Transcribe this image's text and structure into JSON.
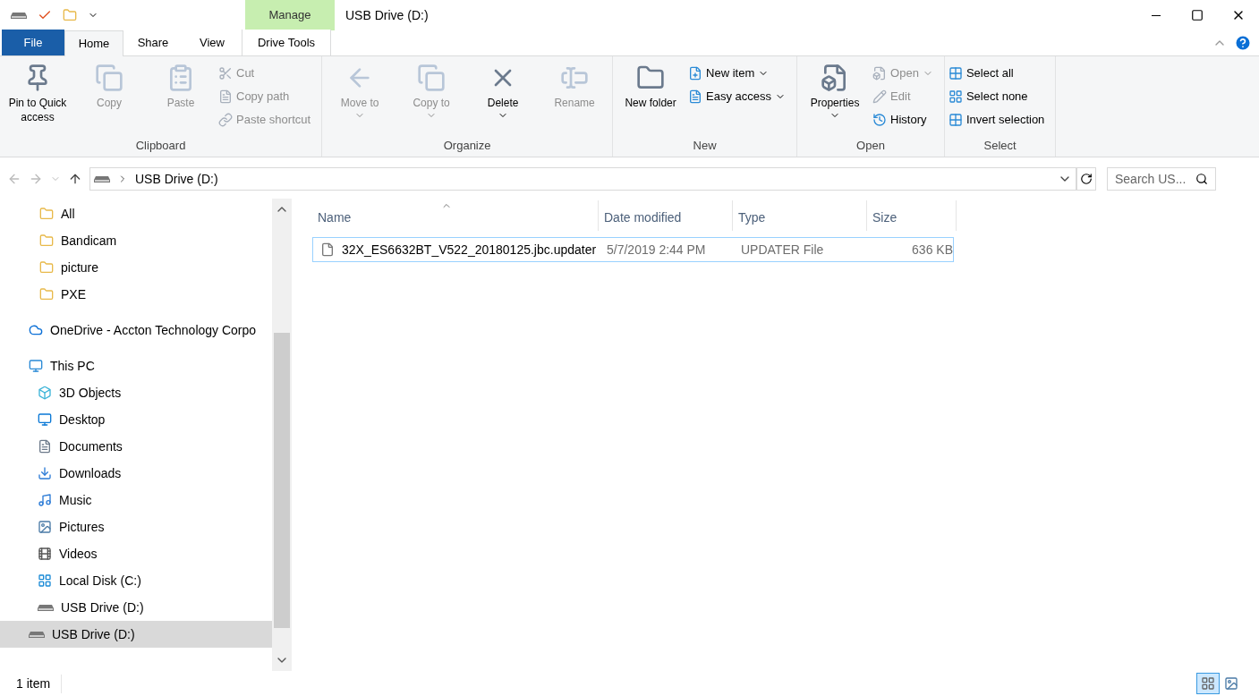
{
  "window": {
    "title": "USB Drive (D:)",
    "context_tab_group": "Manage"
  },
  "tabs": [
    {
      "label": "File",
      "kind": "file",
      "selected": false
    },
    {
      "label": "Home",
      "kind": "tab",
      "selected": true
    },
    {
      "label": "Share",
      "kind": "tab",
      "selected": false
    },
    {
      "label": "View",
      "kind": "tab",
      "selected": false
    },
    {
      "label": "Drive Tools",
      "kind": "context",
      "selected": false
    }
  ],
  "ribbon": [
    {
      "name": "Clipboard",
      "commands": [
        {
          "label": "Pin to Quick access",
          "kind": "large",
          "disabled": false,
          "menu": false
        },
        {
          "label": "Copy",
          "kind": "large",
          "disabled": true,
          "menu": false
        },
        {
          "label": "Paste",
          "kind": "large",
          "disabled": true,
          "menu": false
        },
        {
          "kind": "stack",
          "items": [
            {
              "label": "Cut",
              "disabled": true,
              "menu": false
            },
            {
              "label": "Copy path",
              "disabled": true,
              "menu": false
            },
            {
              "label": "Paste shortcut",
              "disabled": true,
              "menu": false
            }
          ]
        }
      ]
    },
    {
      "name": "Organize",
      "commands": [
        {
          "label": "Move to",
          "kind": "large",
          "disabled": true,
          "menu": true
        },
        {
          "label": "Copy to",
          "kind": "large",
          "disabled": true,
          "menu": true
        },
        {
          "label": "Delete",
          "kind": "large",
          "disabled": false,
          "menu": true
        },
        {
          "label": "Rename",
          "kind": "large",
          "disabled": true,
          "menu": false
        }
      ]
    },
    {
      "name": "New",
      "commands": [
        {
          "label": "New folder",
          "kind": "large",
          "disabled": false,
          "menu": false
        },
        {
          "kind": "stack",
          "items": [
            {
              "label": "New item",
              "disabled": false,
              "menu": true
            },
            {
              "label": "Easy access",
              "disabled": false,
              "menu": true
            }
          ]
        }
      ]
    },
    {
      "name": "Open",
      "commands": [
        {
          "label": "Properties",
          "kind": "large",
          "disabled": false,
          "menu": true
        },
        {
          "kind": "stack",
          "items": [
            {
              "label": "Open",
              "disabled": true,
              "menu": true
            },
            {
              "label": "Edit",
              "disabled": true,
              "menu": false
            },
            {
              "label": "History",
              "disabled": false,
              "menu": false
            }
          ]
        }
      ]
    },
    {
      "name": "Select",
      "commands": [
        {
          "kind": "stack",
          "items": [
            {
              "label": "Select all",
              "disabled": false,
              "menu": false
            },
            {
              "label": "Select none",
              "disabled": false,
              "menu": false
            },
            {
              "label": "Invert selection",
              "disabled": false,
              "menu": false
            }
          ]
        }
      ]
    }
  ],
  "address_bar": {
    "path": "USB Drive (D:)",
    "search_placeholder": "Search US..."
  },
  "navigation": [
    {
      "label": "All",
      "kind": "pinned",
      "selected": false
    },
    {
      "label": "Bandicam",
      "kind": "pinned",
      "selected": false
    },
    {
      "label": "picture",
      "kind": "pinned",
      "selected": false
    },
    {
      "label": "PXE",
      "kind": "pinned",
      "selected": false
    },
    {
      "label": "OneDrive - Accton Technology Corpo",
      "kind": "cloud",
      "selected": false
    },
    {
      "label": "This PC",
      "kind": "pc",
      "selected": false,
      "children": [
        {
          "label": "3D Objects",
          "kind": "cube",
          "selected": false
        },
        {
          "label": "Desktop",
          "kind": "desktop",
          "selected": false
        },
        {
          "label": "Documents",
          "kind": "documents",
          "selected": false
        },
        {
          "label": "Downloads",
          "kind": "downloads",
          "selected": false
        },
        {
          "label": "Music",
          "kind": "music",
          "selected": false
        },
        {
          "label": "Pictures",
          "kind": "pictures",
          "selected": false
        },
        {
          "label": "Videos",
          "kind": "videos",
          "selected": false
        },
        {
          "label": "Local Disk (C:)",
          "kind": "windisk",
          "selected": false
        },
        {
          "label": "USB Drive (D:)",
          "kind": "drive",
          "selected": false
        }
      ]
    },
    {
      "label": "USB Drive (D:)",
      "kind": "drive",
      "selected": true
    }
  ],
  "file_list": {
    "columns": [
      {
        "label": "Name",
        "sorted": true
      },
      {
        "label": "Date modified",
        "sorted": false
      },
      {
        "label": "Type",
        "sorted": false
      },
      {
        "label": "Size",
        "sorted": false
      }
    ],
    "rows": [
      {
        "name": "32X_ES6632BT_V522_20180125.jbc.updater",
        "date_modified": "5/7/2019 2:44 PM",
        "type": "UPDATER File",
        "size": "636 KB",
        "selected": true
      }
    ]
  },
  "status_bar": {
    "count": "1 item"
  }
}
